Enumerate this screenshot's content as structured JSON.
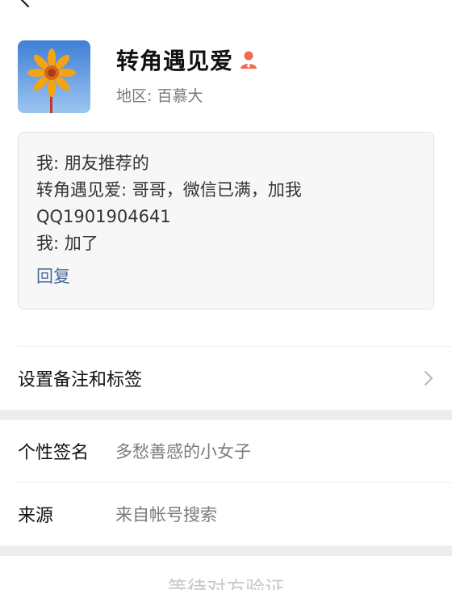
{
  "header": {
    "back_icon": "chevron-left-icon"
  },
  "profile": {
    "nickname": "转角遇见爱",
    "gender_icon": "female-user-icon",
    "region": "地区: 百慕大"
  },
  "message_box": {
    "lines": [
      "我: 朋友推荐的",
      "转角遇见爱: 哥哥，微信已满，加我",
      "QQ1901904641",
      "我: 加了"
    ],
    "reply_label": "回复"
  },
  "settings": {
    "remark_label": "设置备注和标签"
  },
  "details": {
    "signature_label": "个性签名",
    "signature_value": "多愁善感的小女子",
    "source_label": "来源",
    "source_value": "来自帐号搜索"
  },
  "footer": {
    "pending_text": "等待对方验证"
  },
  "colors": {
    "accent_link": "#4a6a9c",
    "gender_icon": "#f26b4f",
    "separator": "#ededed"
  }
}
